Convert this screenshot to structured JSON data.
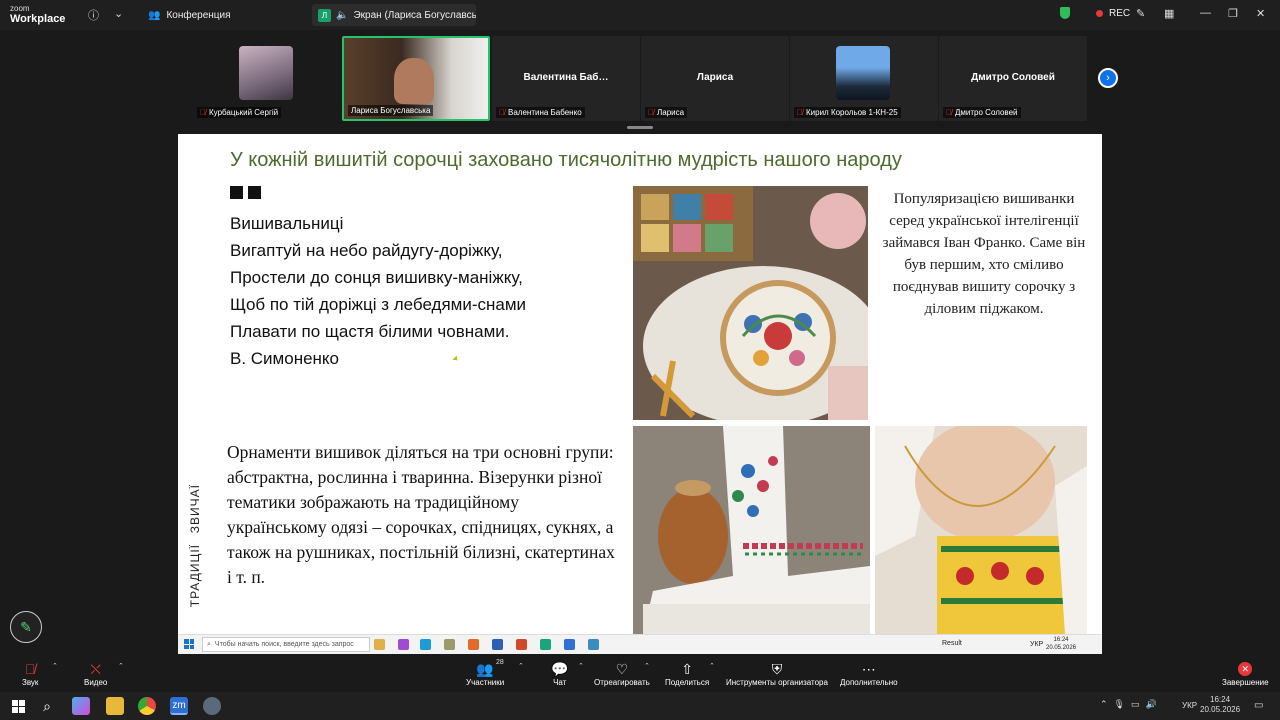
{
  "zoom": {
    "logo_line1": "zoom",
    "logo_line2": "Workplace",
    "meeting_tab": "Конференция",
    "share_tab": "Экран (Лариса Богуславськ",
    "share_badge": "Л",
    "rec": "REC",
    "participants": [
      {
        "big_name": "",
        "label": "Курбацький Сергій",
        "muted": true,
        "has_video": true
      },
      {
        "big_name": "",
        "label": "Лариса Богуславська",
        "muted": false,
        "has_video": true,
        "active": true
      },
      {
        "big_name": "Валентина  Баб…",
        "label": "Валентина Бабенко",
        "muted": true,
        "has_video": false
      },
      {
        "big_name": "Лариса",
        "label": "Лариса",
        "muted": true,
        "has_video": false
      },
      {
        "big_name": "",
        "label": "Кирил Корольов 1-КН-25",
        "muted": true,
        "has_video": true
      },
      {
        "big_name": "Дмитро Соловей",
        "label": "Дмитро Соловей",
        "muted": true,
        "has_video": false
      }
    ],
    "toolbar": {
      "audio": "Звук",
      "video": "Видео",
      "participants": "Участники",
      "participants_count": "28",
      "chat": "Чат",
      "react": "Отреагировать",
      "share": "Поделиться",
      "host_tools": "Инструменты организатора",
      "more": "Дополнительно",
      "end": "Завершение"
    }
  },
  "slide": {
    "title": "У кожній вишитій сорочці заховано тисячолітню мудрість нашого народу",
    "poem": [
      "Вишивальниці",
      "Вигаптуй на небо райдугу-доріжку,",
      "Простели до сонця вишивку-маніжку,",
      "Щоб по тій доріжці з лебедями-снами",
      "Плавати по щастя білими човнами.",
      "В. Симоненко"
    ],
    "sidebar_text": "Популяризацією вишиванки серед української інтелігенції займався Іван Франко. Саме він був першим, хто сміливо поєднував вишиту сорочку з діловим піджаком.",
    "vertical_1": "ЗВИЧАЇ",
    "vertical_2": "ТРАДИЦІЇ",
    "ornament_text": "Орнаменти вишивок діляться на три основні групи: абстрактна, рослинна і тваринна. Візерунки різної тематики зображають на традиційному українському одязі – сорочках, спідницях, сукнях, а також на рушниках, постільній білизні, скатертинах і т. п."
  },
  "inner_taskbar": {
    "search_placeholder": "Чтобы начать поиск, введите здесь запрос",
    "result": "Result",
    "lang": "УКР",
    "time": "16:24",
    "date": "20.05.2026"
  },
  "win_taskbar": {
    "lang": "УКР",
    "time": "16:24",
    "date": "20.05.2026"
  }
}
